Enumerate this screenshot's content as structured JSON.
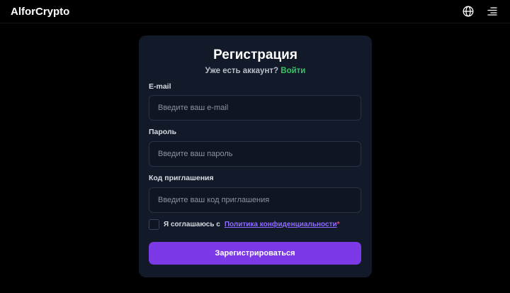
{
  "header": {
    "logo": "AlforCrypto",
    "icons": [
      "globe-icon",
      "menu-icon"
    ]
  },
  "form": {
    "title": "Регистрация",
    "subtitle_prefix": "Уже есть аккаунт?",
    "login_link": "Войти",
    "email_label": "E-mail",
    "email_placeholder": "Введите ваш e-mail",
    "email_value": "",
    "password_label": "Пароль",
    "password_placeholder": "Введите ваш пароль",
    "password_value": "",
    "invite_label": "Код приглашения",
    "invite_placeholder": "Введите ваш код приглашения",
    "invite_value": "",
    "agree_text": "Я соглашаюсь с",
    "policy_link": "Политика конфиденциальности",
    "required_mark": "*",
    "agree_checked": false,
    "submit_label": "Зарегистрироваться"
  },
  "colors": {
    "background": "#000000",
    "card": "#121a29",
    "accent_purple": "#7b3ae6",
    "link_green": "#34c463",
    "link_purple": "#8f6bff"
  }
}
